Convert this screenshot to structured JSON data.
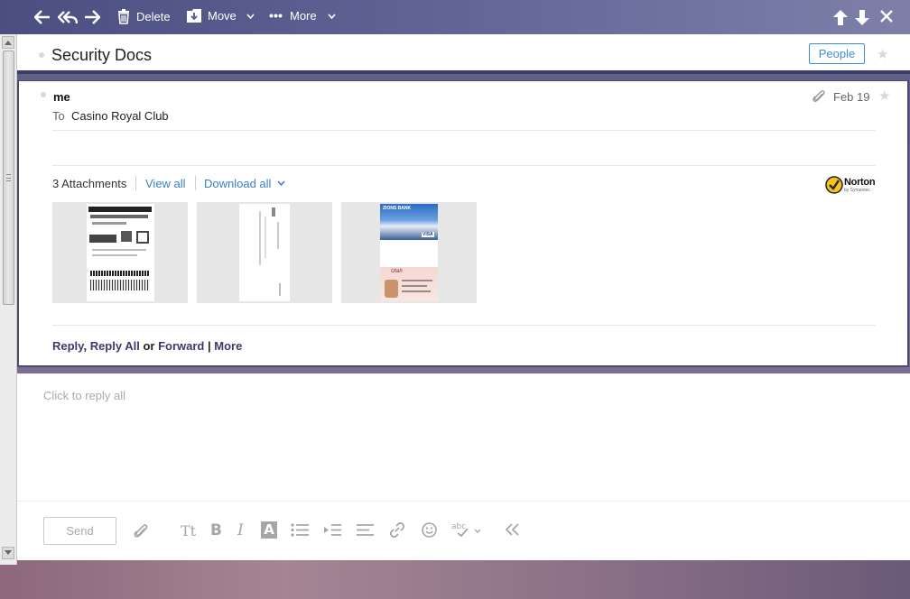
{
  "toolbar": {
    "delete_label": "Delete",
    "move_label": "Move",
    "more_label": "More"
  },
  "subject": {
    "title": "Security Docs",
    "people_label": "People"
  },
  "message": {
    "from": "me",
    "to_label": "To",
    "to_value": "Casino Royal Club",
    "date": "Feb 19"
  },
  "attachments": {
    "count_label": "3 Attachments",
    "view_all_label": "View all",
    "download_all_label": "Download all",
    "scanner_brand": "Norton",
    "scanner_sub": "by Symantec",
    "thumb_texts": [
      "ZIONS BANK",
      "VISA",
      "Utah"
    ]
  },
  "actions": {
    "reply": "Reply",
    "comma": ",",
    "reply_all": "Reply All",
    "or": "or",
    "forward": "Forward",
    "pipe": "|",
    "more": "More"
  },
  "reply": {
    "placeholder": "Click to reply all",
    "send_label": "Send",
    "text_size_glyph": "Tt",
    "bold_glyph": "B",
    "italic_glyph": "I",
    "text_color_glyph": "A",
    "spellcheck_glyph": "abc"
  },
  "colors": {
    "toolbar": "#5f6394",
    "link": "#3a7fc4",
    "accent_border": "#3a3d66"
  }
}
